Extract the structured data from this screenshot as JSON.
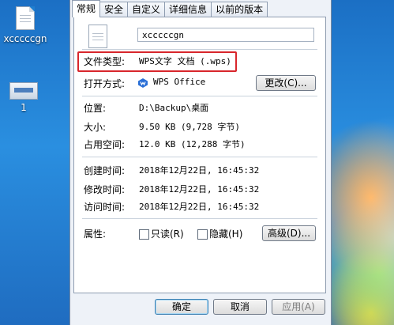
{
  "desktop": {
    "icons": [
      {
        "label": "xcccccgn",
        "icon": "document-icon"
      },
      {
        "label": "1",
        "icon": "recycle-bin-icon"
      }
    ]
  },
  "dialog": {
    "tabs": [
      "常规",
      "安全",
      "自定义",
      "详细信息",
      "以前的版本"
    ],
    "file_name": "xcccccgn",
    "type_label": "文件类型:",
    "type_value": "WPS文字 文档 (.wps)",
    "opens_label": "打开方式:",
    "opens_value": "WPS Office",
    "change_button": "更改(C)...",
    "location_label": "位置:",
    "location_value": "D:\\Backup\\桌面",
    "size_label": "大小:",
    "size_value": "9.50 KB (9,728 字节)",
    "disk_label": "占用空间:",
    "disk_value": "12.0 KB (12,288 字节)",
    "created_label": "创建时间:",
    "created_value": "2018年12月22日, 16:45:32",
    "modified_label": "修改时间:",
    "modified_value": "2018年12月22日, 16:45:32",
    "accessed_label": "访问时间:",
    "accessed_value": "2018年12月22日, 16:45:32",
    "attributes_label": "属性:",
    "readonly_label": "只读(R)",
    "hidden_label": "隐藏(H)",
    "advanced_button": "高级(D)...",
    "ok_button": "确定",
    "cancel_button": "取消",
    "apply_button": "应用(A)"
  },
  "colors": {
    "highlight": "#d8262c",
    "wps_icon": "#2a6fd6"
  }
}
